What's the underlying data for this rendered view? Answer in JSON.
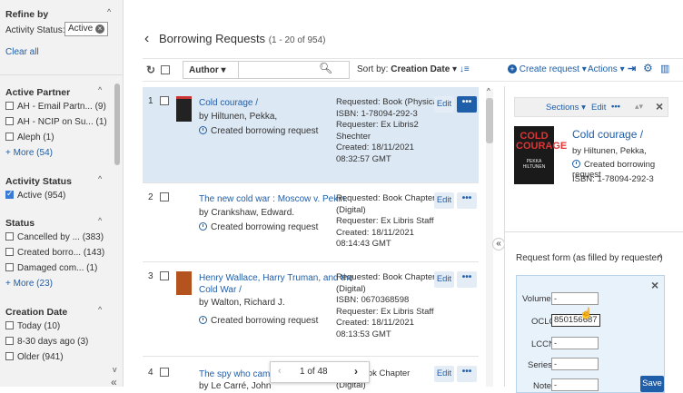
{
  "left": {
    "refine_by": "Refine by",
    "activity_status_label": "Activity Status:",
    "activity_chip": "Active",
    "clear_all": "Clear all",
    "active_partner": {
      "title": "Active Partner",
      "items": [
        "AH - Email Partn... (9)",
        "AH - NCIP on Su... (1)",
        "Aleph (1)"
      ],
      "more": "+ More (54)"
    },
    "activity_status": {
      "title": "Activity Status",
      "items": [
        "Active (954)"
      ]
    },
    "status": {
      "title": "Status",
      "items": [
        "Cancelled by ... (383)",
        "Created borro... (143)",
        "Damaged com... (1)"
      ],
      "more": "+ More (23)"
    },
    "creation_date": {
      "title": "Creation Date",
      "items": [
        "Today (10)",
        "8-30 days ago (3)",
        "Older (941)"
      ]
    }
  },
  "header": {
    "title": "Borrowing Requests",
    "count": "(1 - 20 of 954)"
  },
  "toolbar": {
    "author": "Author",
    "sort_label": "Sort by:",
    "sort_value": "Creation Date",
    "create_request": "Create request",
    "actions": "Actions"
  },
  "items": [
    {
      "num": "1",
      "title": "Cold courage /",
      "author": "by Hiltunen, Pekka,",
      "status": "Created borrowing request",
      "details": [
        "Requested: Book (Physical)",
        "ISBN: 1-78094-292-3",
        "Requester: Ex Libris2",
        "Shechter",
        "Created: 18/11/2021",
        "08:32:57 GMT"
      ]
    },
    {
      "num": "2",
      "title": "The new cold war : Moscow v. Pekin.",
      "author": "by Crankshaw, Edward.",
      "status": "Created borrowing request",
      "details": [
        "Requested: Book Chapter",
        "(Digital)",
        "Requester: Ex Libris Staff",
        "Created: 18/11/2021",
        "08:14:43 GMT"
      ]
    },
    {
      "num": "3",
      "title_lines": [
        "Henry Wallace, Harry Truman, and the",
        "Cold War /"
      ],
      "author": "by Walton, Richard J.",
      "status": "Created borrowing request",
      "details": [
        "Requested: Book Chapter",
        "(Digital)",
        "ISBN: 0670368598",
        "Requester: Ex Libris Staff",
        "Created: 18/11/2021",
        "08:13:53 GMT"
      ]
    },
    {
      "num": "4",
      "title": "The spy who came in fr",
      "author": "by Le Carré, John",
      "details": [
        "sted: Book Chapter",
        "(Digital)"
      ]
    }
  ],
  "edit_label": "Edit",
  "more_label": "•••",
  "pager": {
    "text": "1 of 48"
  },
  "right": {
    "sections": "Sections",
    "edit": "Edit",
    "title": "Cold courage /",
    "author": "by Hiltunen, Pekka,",
    "status": "Created borrowing request",
    "isbn": "ISBN: 1-78094-292-3",
    "cover_title": "COLD COURAGE",
    "cover_author": "PEKKA HILTUNEN",
    "form_title": "Request form (as filled by requester)",
    "fields": [
      {
        "label": "Volume:",
        "value": "-"
      },
      {
        "label": "OCLC:",
        "value": "850156687"
      },
      {
        "label": "LCCN:",
        "value": "-"
      },
      {
        "label": "Series:",
        "value": "-"
      },
      {
        "label": "Note:",
        "value": "-"
      }
    ],
    "save": "Save"
  },
  "colors": {
    "link": "#1f5ea8",
    "selected_row": "#dce8f4",
    "sidebar": "#f2f2f2",
    "save": "#1f5ea8"
  }
}
